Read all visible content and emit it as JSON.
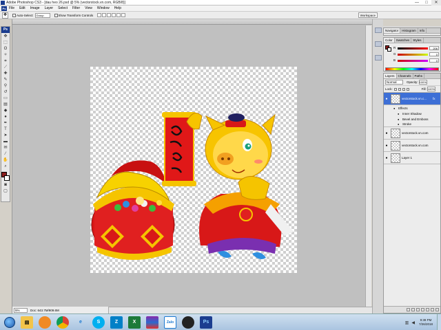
{
  "window": {
    "title": "Adobe Photoshop CS3 - [dau heo 26.psd @ 5% (vectorstock.vn.com, RGB/8)]",
    "min": "—",
    "max": "□",
    "close": "✕"
  },
  "menu": [
    "File",
    "Edit",
    "Image",
    "Layer",
    "Select",
    "Filter",
    "View",
    "Window",
    "Help"
  ],
  "options": {
    "auto_select_label": "Auto-Select:",
    "auto_select_value": "Group",
    "transform_label": "Show Transform Controls",
    "workspace": "Workspace"
  },
  "document": {
    "zoom": "5%",
    "status": "Doc: 643.7M/909.6M"
  },
  "panels": {
    "nav_tabs": [
      "Navigator",
      "Histogram",
      "Info"
    ],
    "color_tabs": [
      "Color",
      "Swatches",
      "Styles"
    ],
    "color": {
      "r_label": "R",
      "r_value": "206",
      "g_label": "G",
      "g_value": "0",
      "b_label": "B",
      "b_value": "0"
    },
    "layer_tabs": [
      "Layers",
      "Channels",
      "Paths"
    ],
    "blend_mode": "Normal",
    "opacity_label": "Opacity:",
    "opacity_value": "100%",
    "lock_label": "Lock:",
    "fill_label": "Fill:",
    "fill_value": "100%",
    "effects_label": "Effects",
    "layers": [
      {
        "name": "vectorstock.vn.c...",
        "fx": "fx",
        "selected": true
      },
      {
        "name": "vectorstock.vn.com",
        "fx": "",
        "selected": false
      },
      {
        "name": "vectorstock.vn.com",
        "fx": "",
        "selected": false
      },
      {
        "name": "Layer 1",
        "fx": "",
        "selected": false
      }
    ],
    "effects": [
      "Inner Shadow",
      "Bevel and Emboss",
      "Stroke"
    ]
  },
  "taskbar": {
    "time": "9:38 PM",
    "date": "7/26/2018",
    "apps": [
      "explorer",
      "firefox",
      "chrome",
      "ie",
      "skype",
      "zalo",
      "excel",
      "winrar",
      "zalo-pc",
      "media",
      "photoshop"
    ]
  },
  "colors": {
    "accent": "#3d6fd6",
    "fg_swatch": "#8b1e1e",
    "ps_blue": "#1b3d8f"
  }
}
